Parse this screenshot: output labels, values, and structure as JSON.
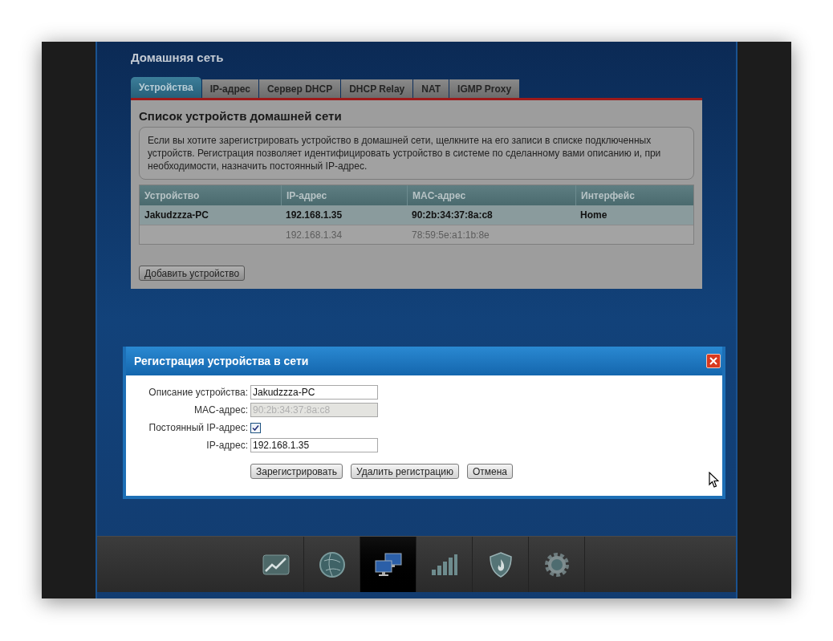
{
  "page": {
    "title": "Домашняя сеть"
  },
  "tabs": [
    {
      "label": "Устройства",
      "selected": true
    },
    {
      "label": "IP-адрес",
      "selected": false
    },
    {
      "label": "Сервер DHCP",
      "selected": false
    },
    {
      "label": "DHCP Relay",
      "selected": false
    },
    {
      "label": "NAT",
      "selected": false
    },
    {
      "label": "IGMP Proxy",
      "selected": false
    }
  ],
  "panel": {
    "heading": "Список устройств домашней сети",
    "info": "Если вы хотите зарегистрировать устройство в домашней сети, щелкните на его записи в списке подключенных устройств. Регистрация позволяет идентифицировать устройство в системе по сделанному вами описанию и, при необходимости, назначить постоянный IP-адрес.",
    "table": {
      "columns": [
        "Устройство",
        "IP-адрес",
        "MAC-адрес",
        "Интерфейс"
      ],
      "rows": [
        {
          "device": "Jakudzzza-PC",
          "ip": "192.168.1.35",
          "mac": "90:2b:34:37:8a:c8",
          "interface": "Home",
          "selected": true
        },
        {
          "ip": "192.168.1.34",
          "mac": "78:59:5e:a1:1b:8e",
          "selected": false
        }
      ]
    },
    "add_button": "Добавить устройство"
  },
  "dialog": {
    "title": "Регистрация устройства в сети",
    "fields": [
      {
        "kind": "text",
        "label": "Описание устройства:",
        "value": "Jakudzzza-PC",
        "disabled": false
      },
      {
        "kind": "text",
        "label": "MAC-адрес:",
        "value": "90:2b:34:37:8a:c8",
        "disabled": true
      },
      {
        "kind": "checkbox",
        "label": "Постоянный IP-адрес:",
        "checked": true
      },
      {
        "kind": "text",
        "label": "IP-адрес:",
        "value": "192.168.1.35",
        "disabled": false
      }
    ],
    "buttons": [
      "Зарегистрировать",
      "Удалить регистрацию",
      "Отмена"
    ]
  },
  "nav": [
    {
      "kind": "chart",
      "selected": false
    },
    {
      "kind": "globe",
      "selected": false
    },
    {
      "kind": "network",
      "selected": true
    },
    {
      "kind": "signal",
      "selected": false
    },
    {
      "kind": "shield",
      "selected": false
    },
    {
      "kind": "gear",
      "selected": false
    }
  ]
}
